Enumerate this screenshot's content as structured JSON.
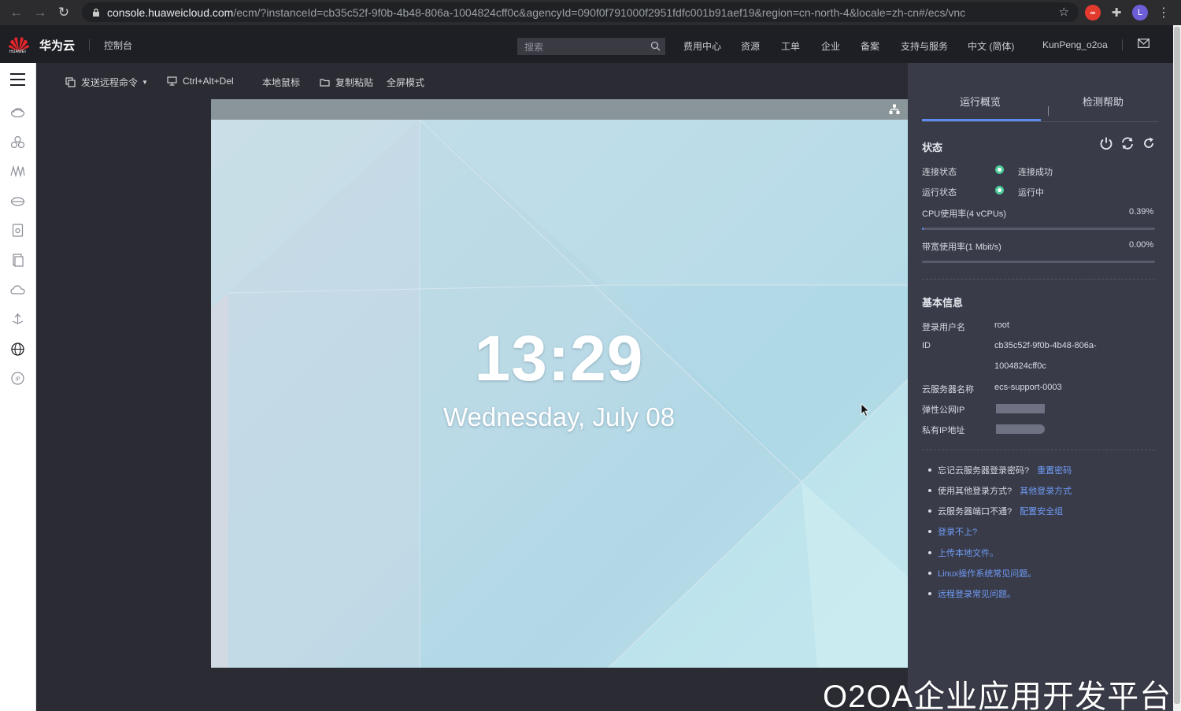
{
  "browser": {
    "url_host": "console.huaweicloud.com",
    "url_path": "/ecm/?instanceId=cb35c52f-9f0b-4b48-806a-1004824cff0c&agencyId=090f0f791000f2951fdfc001b91aef19&region=cn-north-4&locale=zh-cn#/ecs/vnc",
    "ext_badge": "∞",
    "avatar_letter": "L"
  },
  "header": {
    "logo_text": "HUAWEI",
    "brand": "华为云",
    "console": "控制台",
    "search_placeholder": "搜索",
    "nav": [
      "费用中心",
      "资源",
      "工单",
      "企业",
      "备案",
      "支持与服务",
      "中文 (简体)",
      "KunPeng_o2oa"
    ]
  },
  "toolbar": {
    "send_command": "发送远程命令",
    "ctrl_alt_del": "Ctrl+Alt+Del",
    "local_mouse": "本地鼠标",
    "copy_paste": "复制粘贴",
    "fullscreen": "全屏模式"
  },
  "desktop": {
    "time": "13:29",
    "date": "Wednesday, July 08"
  },
  "panel": {
    "tabs": [
      "运行概览",
      "检测帮助"
    ],
    "status_title": "状态",
    "connection_label": "连接状态",
    "connection_value": "连接成功",
    "running_label": "运行状态",
    "running_value": "运行中",
    "cpu_label": "CPU使用率(4 vCPUs)",
    "cpu_value": "0.39%",
    "cpu_fraction": 0.0039,
    "bandwidth_label": "带宽使用率(1 Mbit/s)",
    "bandwidth_value": "0.00%",
    "bandwidth_fraction": 0.0,
    "basic_title": "基本信息",
    "user_label": "登录用户名",
    "user_value": "root",
    "id_label": "ID",
    "id_line1": "cb35c52f-9f0b-4b48-806a-",
    "id_line2": "1004824cff0c",
    "server_label": "云服务器名称",
    "server_value": "ecs-support-0003",
    "eip_label": "弹性公网IP",
    "private_ip_label": "私有IP地址",
    "help": [
      {
        "text": "忘记云服务器登录密码?",
        "link": "重置密码"
      },
      {
        "text": "使用其他登录方式?",
        "link": "其他登录方式"
      },
      {
        "text": "云服务器端口不通?",
        "link": "配置安全组"
      },
      {
        "text": "",
        "link": "登录不上?"
      },
      {
        "text": "",
        "link": "上传本地文件。"
      },
      {
        "text": "",
        "link": "Linux操作系统常见问题。"
      },
      {
        "text": "",
        "link": "远程登录常见问题。"
      }
    ]
  },
  "watermark": "O2OA企业应用开发平台",
  "colors": {
    "accent": "#5c8bf0",
    "status_ok": "#4ccc9a",
    "panel_bg": "#393b48"
  }
}
